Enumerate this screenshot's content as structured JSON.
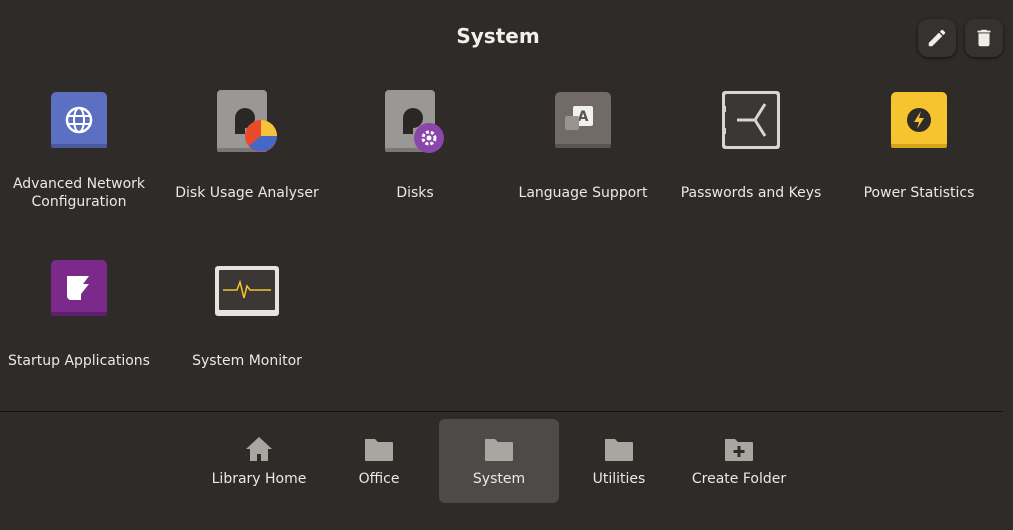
{
  "header": {
    "title": "System",
    "edit_icon": "pencil-icon",
    "delete_icon": "trash-icon"
  },
  "apps": [
    {
      "label": "Advanced Network Configuration",
      "icon": "network-globe-icon"
    },
    {
      "label": "Disk Usage Analyser",
      "icon": "disk-usage-pie-icon"
    },
    {
      "label": "Disks",
      "icon": "disks-gear-icon"
    },
    {
      "label": "Language Support",
      "icon": "language-icon"
    },
    {
      "label": "Passwords and Keys",
      "icon": "passwords-keys-icon"
    },
    {
      "label": "Power Statistics",
      "icon": "power-bolt-icon"
    },
    {
      "label": "Startup Applications",
      "icon": "startup-applications-icon"
    },
    {
      "label": "System Monitor",
      "icon": "system-monitor-icon"
    }
  ],
  "nav": [
    {
      "label": "Library Home",
      "icon": "home-icon",
      "active": false
    },
    {
      "label": "Office",
      "icon": "folder-icon",
      "active": false
    },
    {
      "label": "System",
      "icon": "folder-icon",
      "active": true
    },
    {
      "label": "Utilities",
      "icon": "folder-icon",
      "active": false
    },
    {
      "label": "Create Folder",
      "icon": "folder-add-icon",
      "active": false
    }
  ],
  "colors": {
    "background": "#2e2b28",
    "active_nav": "#4d4a47",
    "network_icon": "#5d6fc0",
    "power_icon": "#f5c42f",
    "startup_icon": "#7b2a8c"
  }
}
